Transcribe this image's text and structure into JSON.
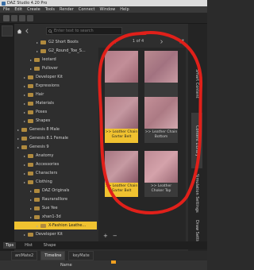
{
  "window": {
    "title": "DAZ Studio 4.20 Pro"
  },
  "menu": [
    "File",
    "Edit",
    "Create",
    "Tools",
    "Render",
    "Connect",
    "Window",
    "Help"
  ],
  "search": {
    "placeholder": "Enter text to search"
  },
  "pager": {
    "page_info": "1 of 4"
  },
  "tree": [
    {
      "label": "G2 Short Boots",
      "indent": 3,
      "folder": true
    },
    {
      "label": "G2_Round_Toe_S...",
      "indent": 3,
      "folder": true
    },
    {
      "label": "leotard",
      "indent": 2,
      "folder": true
    },
    {
      "label": "Pullover",
      "indent": 2,
      "folder": true
    },
    {
      "label": "Developer Kit",
      "indent": 1,
      "folder": true
    },
    {
      "label": "Expressions",
      "indent": 1,
      "folder": true
    },
    {
      "label": "Hair",
      "indent": 1,
      "folder": true
    },
    {
      "label": "Materials",
      "indent": 1,
      "folder": true
    },
    {
      "label": "Poses",
      "indent": 1,
      "folder": true
    },
    {
      "label": "Shapes",
      "indent": 1,
      "folder": true
    },
    {
      "label": "Genesis 8 Male",
      "indent": 0,
      "folder": true
    },
    {
      "label": "Genesis 8.1 Female",
      "indent": 0,
      "folder": true
    },
    {
      "label": "Genesis 9",
      "indent": 0,
      "folder": true
    },
    {
      "label": "Anatomy",
      "indent": 1,
      "folder": true
    },
    {
      "label": "Accessories",
      "indent": 1,
      "folder": true
    },
    {
      "label": "Characters",
      "indent": 1,
      "folder": true
    },
    {
      "label": "Clothing",
      "indent": 1,
      "folder": true
    },
    {
      "label": "DAZ Originals",
      "indent": 2,
      "folder": true
    },
    {
      "label": "Rauraralllore",
      "indent": 2,
      "folder": true
    },
    {
      "label": "Sue Yee",
      "indent": 2,
      "folder": true
    },
    {
      "label": "xhan1-3d",
      "indent": 2,
      "folder": true
    },
    {
      "label": "X-Fashion Leathe...",
      "indent": 3,
      "folder": true,
      "selected": true
    },
    {
      "label": "Developer Kit",
      "indent": 1,
      "folder": true
    }
  ],
  "thumbnails": [
    {
      "caption": "",
      "selected": false,
      "colors": [
        "#b07a86",
        "#c28e98",
        "#9a6470"
      ]
    },
    {
      "caption": "",
      "selected": false,
      "colors": [
        "#b98a90",
        "#a27280",
        "#c89aa2"
      ]
    },
    {
      "caption": ">> Leather Chain Garter Belt",
      "selected": true,
      "colors": [
        "#b5808a",
        "#c497a0",
        "#8e5d6a"
      ]
    },
    {
      "caption": ">> Leather Chain Bottom",
      "selected": false,
      "colors": [
        "#c49098",
        "#ac7a84",
        "#d2a8ae"
      ]
    },
    {
      "caption": ">> Leather Chain Garter Belt",
      "selected": true,
      "colors": [
        "#a67480",
        "#c69aa2",
        "#8a5866"
      ]
    },
    {
      "caption": ">> Leather Choker Top",
      "selected": false,
      "colors": [
        "#bd8a94",
        "#d4a2aa",
        "#9c6a76"
      ]
    }
  ],
  "pane_footer": {
    "plus": "+",
    "minus": "−"
  },
  "right_tabs": [
    "Smart Content",
    "Content Library",
    "Simulation Settings",
    "Draw Settings"
  ],
  "bottom_tabs": [
    "Tips",
    "Hist",
    "Shape"
  ],
  "timeline_tabs": [
    "aniMate2",
    "Timeline",
    "keyMate"
  ],
  "timeline": {
    "name_label": "Name"
  },
  "colors": {
    "accent": "#f0c230",
    "annotation": "#e0201a",
    "background": "#2b2b2b"
  }
}
